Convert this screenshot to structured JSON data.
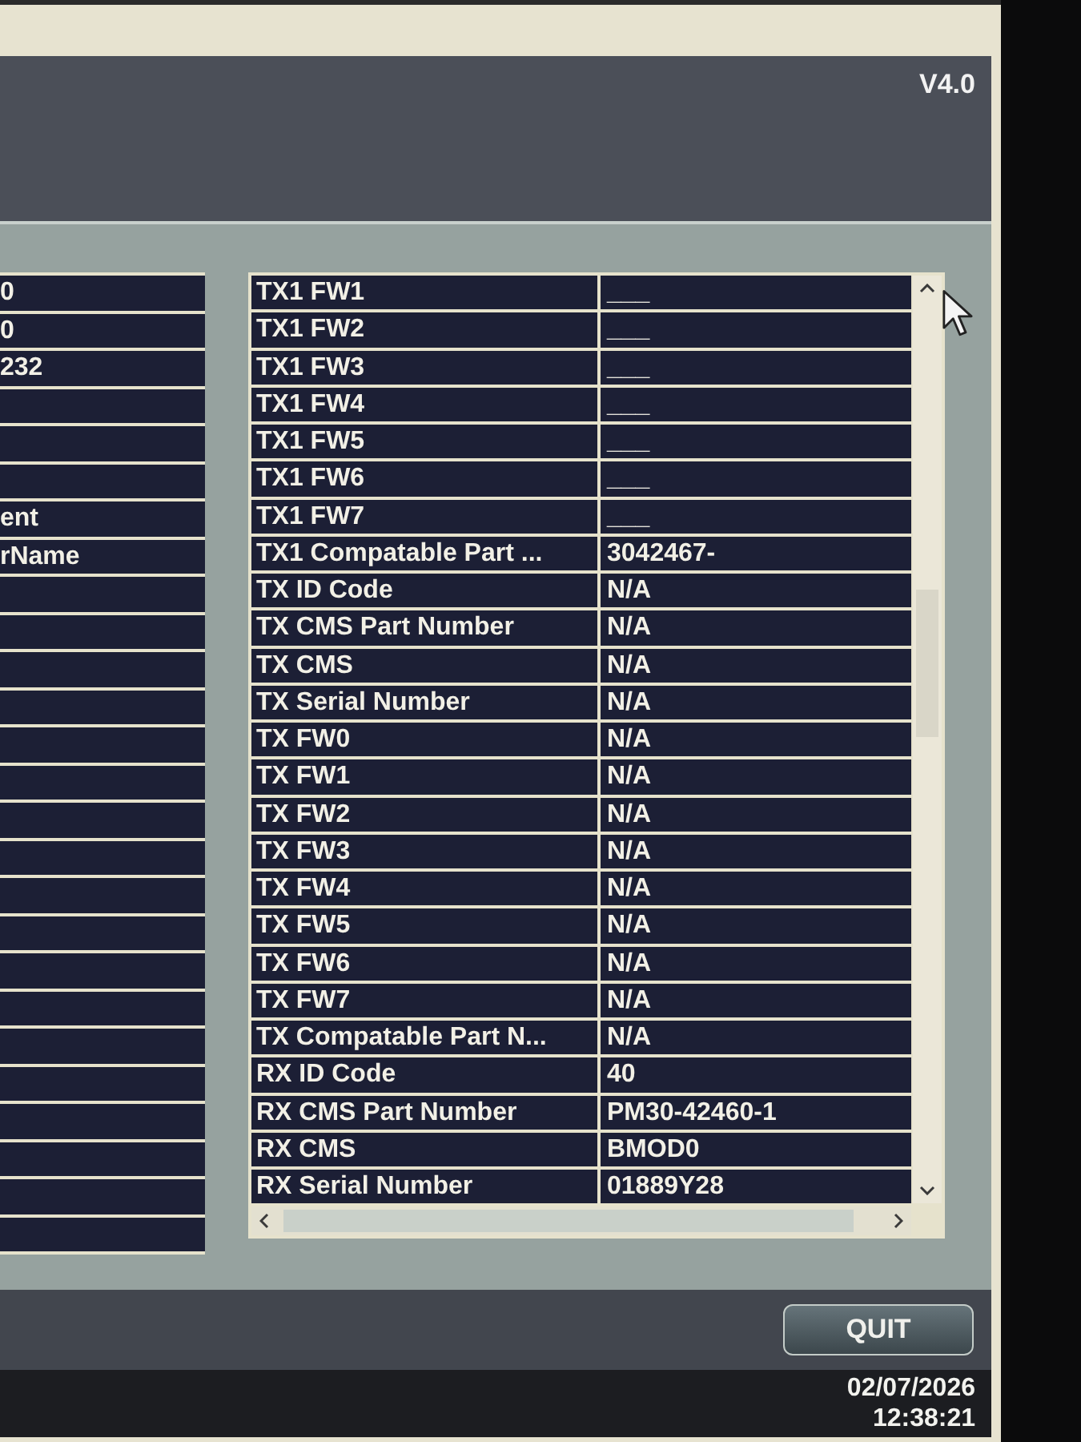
{
  "header": {
    "version": "V4.0"
  },
  "left_table": {
    "rows": [
      {
        "value": "0"
      },
      {
        "value": "0"
      },
      {
        "value": "232"
      },
      {},
      {},
      {},
      {
        "value": "ent"
      },
      {
        "value": "rName"
      },
      {},
      {},
      {},
      {},
      {},
      {},
      {},
      {},
      {},
      {},
      {},
      {},
      {},
      {},
      {},
      {},
      {},
      {}
    ]
  },
  "right_table": {
    "rows": [
      {
        "label": "TX1 FW1",
        "value": "___"
      },
      {
        "label": "TX1 FW2",
        "value": "___"
      },
      {
        "label": "TX1 FW3",
        "value": "___"
      },
      {
        "label": "TX1 FW4",
        "value": "___"
      },
      {
        "label": "TX1 FW5",
        "value": "___"
      },
      {
        "label": "TX1 FW6",
        "value": "___"
      },
      {
        "label": "TX1 FW7",
        "value": "___"
      },
      {
        "label": "TX1 Compatable Part ...",
        "value": "3042467-"
      },
      {
        "label": "TX ID Code",
        "value": "N/A"
      },
      {
        "label": "TX CMS Part Number",
        "value": "N/A"
      },
      {
        "label": "TX CMS",
        "value": "N/A"
      },
      {
        "label": "TX Serial Number",
        "value": "N/A"
      },
      {
        "label": "TX FW0",
        "value": "N/A"
      },
      {
        "label": "TX FW1",
        "value": "N/A"
      },
      {
        "label": "TX FW2",
        "value": "N/A"
      },
      {
        "label": "TX FW3",
        "value": "N/A"
      },
      {
        "label": "TX FW4",
        "value": "N/A"
      },
      {
        "label": "TX FW5",
        "value": "N/A"
      },
      {
        "label": "TX FW6",
        "value": "N/A"
      },
      {
        "label": "TX FW7",
        "value": "N/A"
      },
      {
        "label": "TX Compatable Part N...",
        "value": "N/A"
      },
      {
        "label": "RX ID Code",
        "value": "40"
      },
      {
        "label": "RX CMS Part Number",
        "value": "PM30-42460-1"
      },
      {
        "label": "RX CMS",
        "value": "BMOD0"
      },
      {
        "label": "RX Serial Number",
        "value": "01889Y28"
      }
    ]
  },
  "quit_button": {
    "label": "QUIT"
  },
  "status_bar": {
    "date": "02/07/2026",
    "time": "12:38:21"
  }
}
